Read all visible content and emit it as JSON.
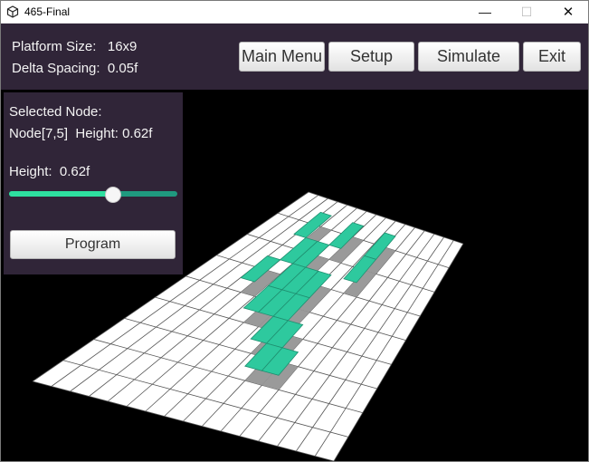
{
  "window": {
    "title": "465-Final",
    "controls": {
      "minimize": "—",
      "maximize": "☐",
      "close": "✕"
    }
  },
  "topbar": {
    "platform_size": "Platform Size:   16x9",
    "delta_spacing": "Delta Spacing:  0.05f",
    "buttons": {
      "main_menu": "Main Menu",
      "setup": "Setup",
      "simulate": "Simulate",
      "exit": "Exit"
    }
  },
  "side_panel": {
    "selected_node_label": "Selected Node:",
    "node_info": "Node[7,5]  Height: 0.62f",
    "height_label": "Height:  0.62f",
    "slider_value": 0.62,
    "program_button": "Program"
  },
  "scene": {
    "grid_cols": 16,
    "grid_rows": 9,
    "raised_color": "#2ec99e",
    "platform_color": "#ffffff",
    "background_color": "#000000",
    "raised_cells": [
      [
        6,
        5
      ],
      [
        7,
        5
      ],
      [
        8,
        5
      ],
      [
        6,
        4
      ],
      [
        7,
        4
      ],
      [
        8,
        4
      ],
      [
        8,
        3
      ],
      [
        9,
        3
      ],
      [
        9,
        2
      ],
      [
        10,
        2
      ],
      [
        4,
        5
      ],
      [
        5,
        6
      ],
      [
        6,
        6
      ],
      [
        4,
        7
      ],
      [
        7,
        7
      ],
      [
        10,
        7
      ],
      [
        10,
        6
      ]
    ]
  },
  "colors": {
    "panel": "#302538",
    "slider_fill": "#2ee0a0",
    "slider_track": "#1f9a7f"
  }
}
